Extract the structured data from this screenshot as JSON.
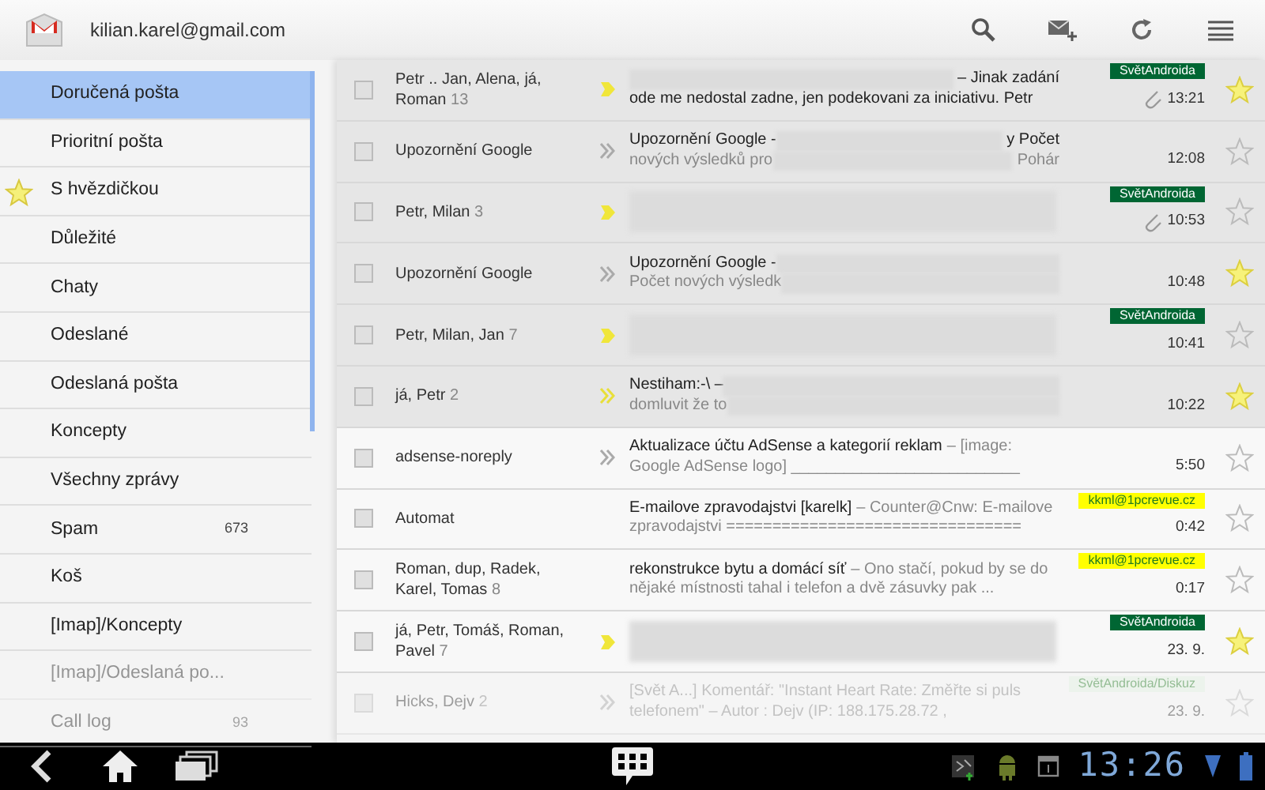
{
  "account": {
    "email": "kilian.karel@gmail.com"
  },
  "sidebar": {
    "items": [
      {
        "label": "Doručená pošta",
        "selected": true
      },
      {
        "label": "Prioritní pošta",
        "selected": false
      },
      {
        "label": "S hvězdičkou",
        "selected": false,
        "kind": "starred"
      },
      {
        "label": "Důležité",
        "selected": false
      },
      {
        "label": "Chaty",
        "selected": false
      },
      {
        "label": "Odeslané",
        "selected": false
      },
      {
        "label": "Odeslaná pošta",
        "selected": false
      },
      {
        "label": "Koncepty",
        "selected": false
      },
      {
        "label": "Všechny zprávy",
        "selected": false
      },
      {
        "label": "Spam",
        "count": "673",
        "selected": false
      },
      {
        "label": "Koš",
        "selected": false
      },
      {
        "label": "[Imap]/Koncepty",
        "selected": false
      },
      {
        "label": "[Imap]/Odeslaná po...",
        "selected": false,
        "faded": true
      },
      {
        "label": "Call log",
        "count": "93",
        "selected": false,
        "faded": true
      }
    ]
  },
  "messages": [
    {
      "sender": "Petr .. Jan, Alena, já, Roman",
      "count": "13",
      "checked": false,
      "read": true,
      "important": true,
      "to_me": false,
      "lines": [
        [
          {
            "kind": "redacted"
          },
          {
            "kind": "subject",
            "text": "– Jinak zadání"
          }
        ],
        [
          {
            "kind": "subject",
            "text": "ode me nedostal zadne, jen podekovani za iniciativu. Petr"
          }
        ]
      ],
      "label": {
        "text": "SvětAndroida",
        "color": "#006633"
      },
      "attachment": true,
      "time": "13:21",
      "starred": true
    },
    {
      "sender": "Upozornění Google",
      "checked": false,
      "read": true,
      "important": false,
      "to_me": true,
      "lines": [
        [
          {
            "kind": "subject",
            "text": "Upozornění Google -"
          },
          {
            "kind": "redacted"
          },
          {
            "kind": "subject",
            "text": "y Počet"
          }
        ],
        [
          {
            "kind": "snippet",
            "text": "nových výsledků pro"
          },
          {
            "kind": "redacted"
          },
          {
            "kind": "snippet",
            "text": "Pohár"
          }
        ]
      ],
      "time": "12:08",
      "starred": false
    },
    {
      "sender": "Petr, Milan",
      "count": "3",
      "checked": false,
      "read": true,
      "important": true,
      "to_me": false,
      "blurred": true,
      "label": {
        "text": "SvětAndroida",
        "color": "#006633"
      },
      "attachment": true,
      "time": "10:53",
      "starred": false
    },
    {
      "sender": "Upozornění Google",
      "checked": false,
      "read": true,
      "important": false,
      "to_me": true,
      "lines": [
        [
          {
            "kind": "subject",
            "text": "Upozornění Google -"
          },
          {
            "kind": "redacted"
          }
        ],
        [
          {
            "kind": "snippet",
            "text": "Počet nových výsledk"
          },
          {
            "kind": "redacted"
          }
        ]
      ],
      "time": "10:48",
      "starred": true
    },
    {
      "sender": "Petr, Milan, Jan",
      "count": "7",
      "checked": false,
      "read": true,
      "important": true,
      "to_me": false,
      "blurred": true,
      "label": {
        "text": "SvětAndroida",
        "color": "#006633"
      },
      "time": "10:41",
      "starred": false
    },
    {
      "sender": "já, Petr",
      "count": "2",
      "checked": false,
      "read": true,
      "important": true,
      "to_me": true,
      "lines": [
        [
          {
            "kind": "subject",
            "text": "Nestiham:-\\ –"
          },
          {
            "kind": "redacted"
          }
        ],
        [
          {
            "kind": "snippet",
            "text": "domluvit že to"
          },
          {
            "kind": "redacted"
          }
        ]
      ],
      "time": "10:22",
      "starred": true
    },
    {
      "sender": "adsense-noreply",
      "checked": false,
      "read": false,
      "important": false,
      "to_me": true,
      "lines": [
        [
          {
            "kind": "subject",
            "text": "Aktualizace účtu AdSense a kategorií reklam"
          },
          {
            "kind": "snippet",
            "text": "– [image:"
          }
        ],
        [
          {
            "kind": "snippet",
            "text": "Google AdSense logo] __________________________"
          }
        ]
      ],
      "time": "5:50",
      "starred": false
    },
    {
      "sender": "Automat",
      "checked": false,
      "read": false,
      "lines": [
        [
          {
            "kind": "subject",
            "text": "E-mailove zpravodajstvi [karelk]"
          },
          {
            "kind": "snippet",
            "text": "– Counter@Cnw: E-mailove"
          }
        ],
        [
          {
            "kind": "snippet",
            "text": "zpravodajstvi ================================"
          }
        ]
      ],
      "label": {
        "text": "kkml@1pcrevue.cz",
        "color": "#ffff00"
      },
      "time": "0:42",
      "starred": false
    },
    {
      "sender": "Roman, dup, Radek, Karel, Tomas",
      "count": "8",
      "checked": false,
      "read": false,
      "lines": [
        [
          {
            "kind": "subject",
            "text": "rekonstrukce bytu a domácí síť"
          },
          {
            "kind": "snippet",
            "text": "– Ono stačí, pokud by se do"
          }
        ],
        [
          {
            "kind": "snippet",
            "text": "nějaké místnosti tahal i telefon a dvě zásuvky pak ..."
          }
        ]
      ],
      "label": {
        "text": "kkml@1pcrevue.cz",
        "color": "#ffff00"
      },
      "time": "0:17",
      "starred": false
    },
    {
      "sender": "já, Petr, Tomáš, Roman, Pavel",
      "count": "7",
      "checked": false,
      "read": false,
      "important": true,
      "to_me": false,
      "blurred": true,
      "label": {
        "text": "SvětAndroida",
        "color": "#006633"
      },
      "time": "23. 9.",
      "starred": true
    },
    {
      "sender": "Hicks, Dejv",
      "count": "2",
      "checked": false,
      "read": false,
      "faded": true,
      "important": false,
      "to_me": true,
      "lines": [
        [
          {
            "kind": "snippet",
            "text": "[Svět A...] Komentář: \"Instant Heart Rate: Změřte si puls"
          }
        ],
        [
          {
            "kind": "snippet",
            "text": "telefonem\" – Autor : Dejv (IP: 188.175.28.72 ,"
          }
        ]
      ],
      "label": {
        "text": "SvětAndroida/Diskuz",
        "color": "#e3f2e3"
      },
      "time": "23. 9.",
      "starred": false
    }
  ],
  "status_bar": {
    "clock": "13:26"
  }
}
